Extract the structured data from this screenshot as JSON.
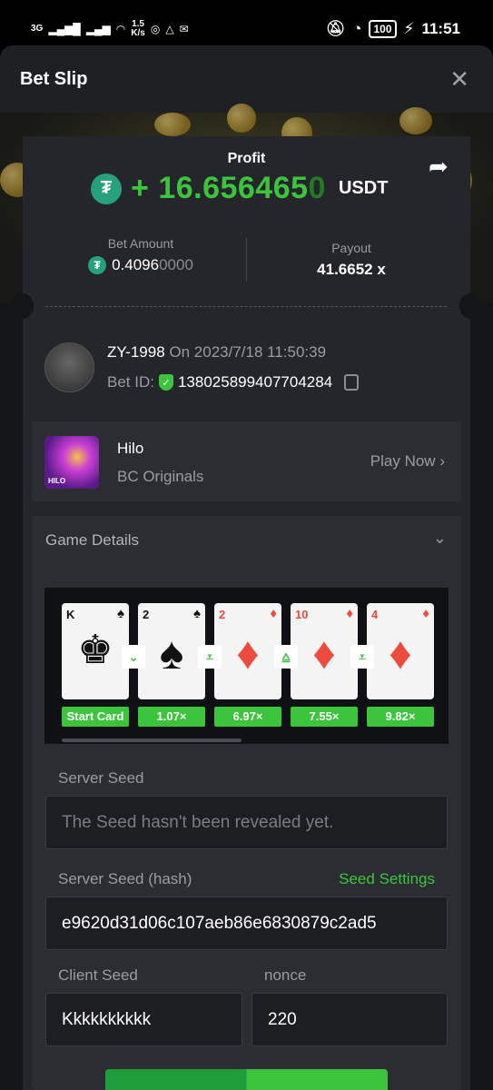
{
  "status_bar": {
    "network": "3G",
    "speed_value": "1.5",
    "speed_unit": "K/s",
    "battery": "100",
    "time": "11:51"
  },
  "header": {
    "title": "Bet Slip"
  },
  "profit": {
    "label": "Profit",
    "prefix": "+ ",
    "value_main": "16.656465",
    "value_dim": "0",
    "currency": "USDT"
  },
  "bet_amount": {
    "label": "Bet Amount",
    "main": "0.4096",
    "dim": "0000"
  },
  "payout": {
    "label": "Payout",
    "value": "41.6652 x"
  },
  "user": {
    "name": "ZY-1998",
    "on": "On 2023/7/18",
    "time": "11:50:39",
    "bet_id_label": "Bet ID:",
    "bet_id": "138025899407704284"
  },
  "game": {
    "name": "Hilo",
    "provider": "BC Originals",
    "play": "Play Now",
    "thumb_label": "HILO"
  },
  "details": {
    "title": "Game Details",
    "cards": [
      {
        "rank": "K",
        "suit": "♠",
        "color": "black",
        "mult": "Start Card"
      },
      {
        "rank": "2",
        "suit": "♠",
        "color": "black",
        "mult": "1.07×",
        "arrow": "lower"
      },
      {
        "rank": "2",
        "suit": "♦",
        "color": "red",
        "mult": "6.97×",
        "arrow": "lower-or-same"
      },
      {
        "rank": "10",
        "suit": "♦",
        "color": "red",
        "mult": "7.55×",
        "arrow": "higher-or-same"
      },
      {
        "rank": "4",
        "suit": "♦",
        "color": "red",
        "mult": "9.82×",
        "arrow": "lower-or-same"
      }
    ],
    "server_seed_label": "Server Seed",
    "server_seed_placeholder": "The Seed hasn't been revealed yet.",
    "server_hash_label": "Server Seed (hash)",
    "seed_settings": "Seed Settings",
    "server_hash": "e9620d31d06c107aeb86e6830879c2ad5",
    "client_seed_label": "Client Seed",
    "client_seed": "Kkkkkkkkkk",
    "nonce_label": "nonce",
    "nonce": "220"
  }
}
